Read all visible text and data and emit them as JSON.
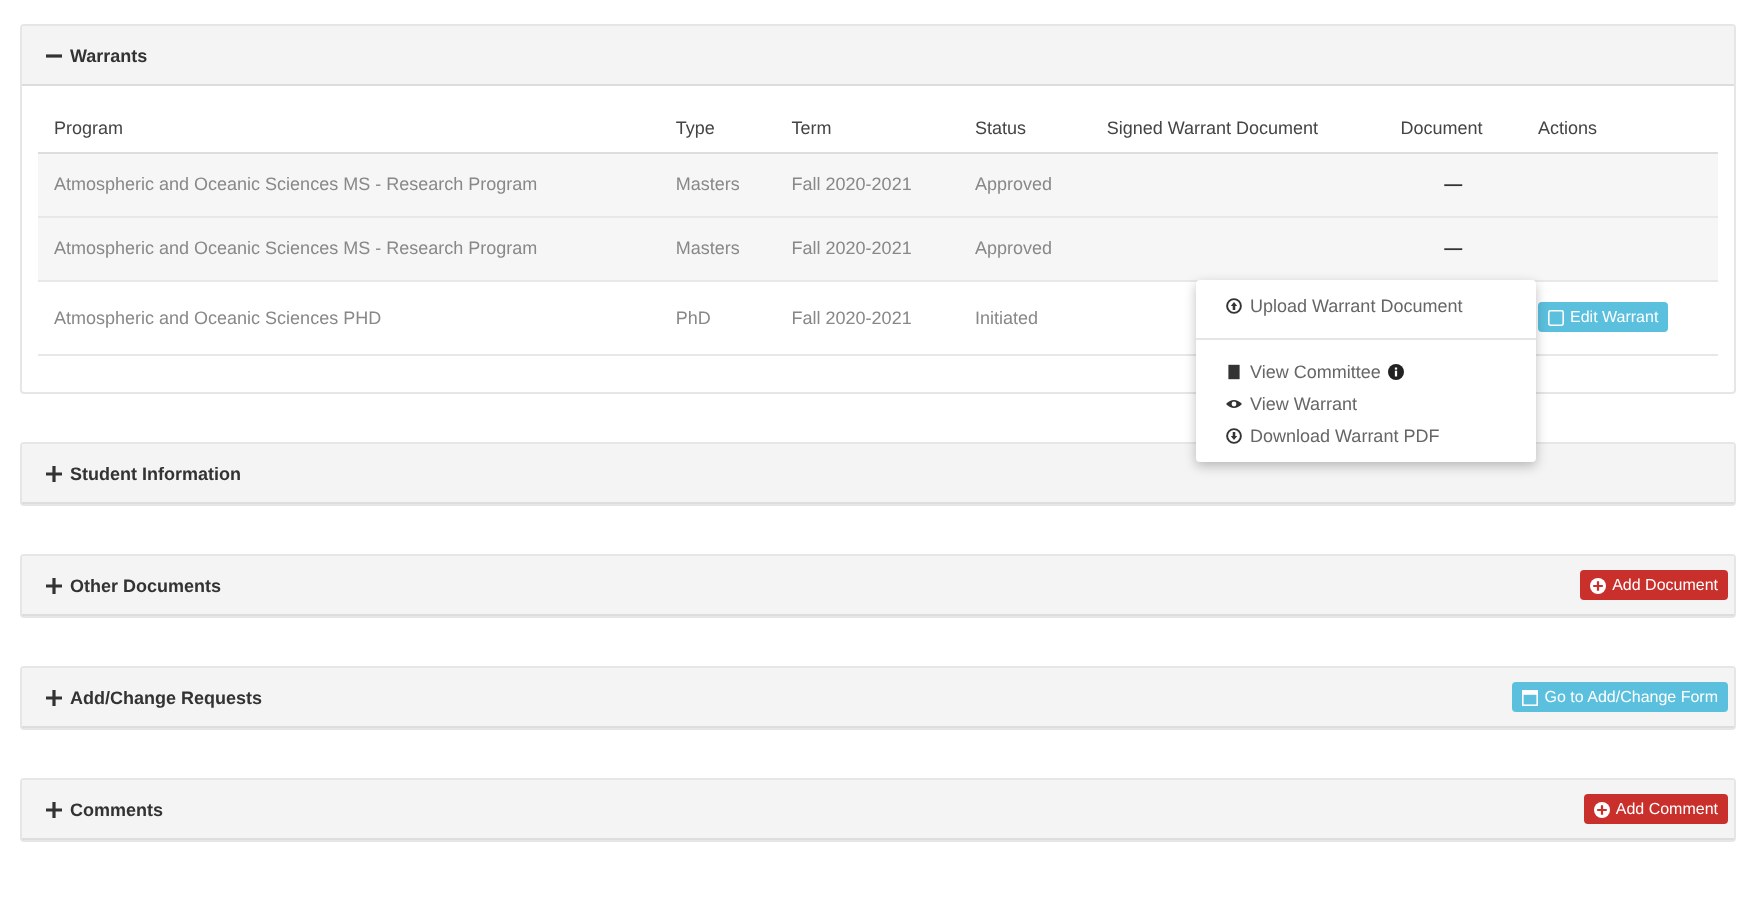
{
  "sections": [
    {
      "title": "Warrants",
      "expanded": true
    },
    {
      "title": "Student Information",
      "expanded": false
    },
    {
      "title": "Other Documents",
      "expanded": false,
      "button": {
        "label": "Add Document",
        "kind": "danger"
      }
    },
    {
      "title": "Add/Change Requests",
      "expanded": false,
      "button": {
        "label": "Go to Add/Change Form",
        "kind": "info"
      }
    },
    {
      "title": "Comments",
      "expanded": false,
      "button": {
        "label": "Add Comment",
        "kind": "danger"
      }
    }
  ],
  "warrants": {
    "columns": [
      "Program",
      "Type",
      "Term",
      "Status",
      "Signed Warrant Document",
      "Document",
      "Actions"
    ],
    "rows": [
      {
        "program": "Atmospheric and Oceanic Sciences MS - Research Program",
        "type": "Masters",
        "term": "Fall 2020-2021",
        "status": "Approved",
        "document": "—"
      },
      {
        "program": "Atmospheric and Oceanic Sciences MS - Research Program",
        "type": "Masters",
        "term": "Fall 2020-2021",
        "status": "Approved",
        "document": "—"
      },
      {
        "program": "Atmospheric and Oceanic Sciences PHD",
        "type": "PhD",
        "term": "Fall 2020-2021",
        "status": "Initiated",
        "action": "Edit Warrant"
      }
    ]
  },
  "menu": [
    {
      "label": "Upload Warrant Document",
      "kind": "upload",
      "divider_after": true
    },
    {
      "label": "View Committee",
      "kind": "committee",
      "info": true
    },
    {
      "label": "View Warrant",
      "kind": "view"
    },
    {
      "label": "Download Warrant PDF",
      "kind": "download"
    }
  ]
}
